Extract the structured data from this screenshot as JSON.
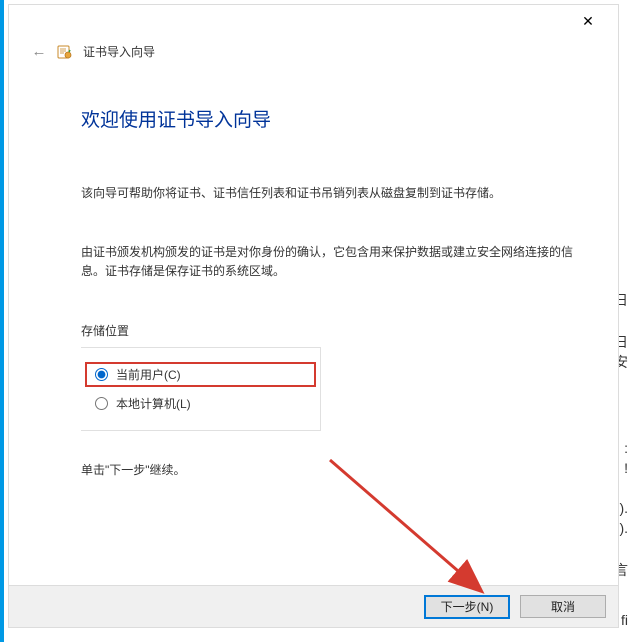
{
  "window": {
    "close_glyph": "✕"
  },
  "header": {
    "back_glyph": "←",
    "label": "证书导入向导"
  },
  "content": {
    "heading": "欢迎使用证书导入向导",
    "paragraph1": "该向导可帮助你将证书、证书信任列表和证书吊销列表从磁盘复制到证书存储。",
    "paragraph2": "由证书颁发机构颁发的证书是对你身份的确认，它包含用来保护数据或建立安全网络连接的信息。证书存储是保存证书的系统区域。",
    "storage_label": "存储位置",
    "radio_current_user": "当前用户(C)",
    "radio_local_machine": "本地计算机(L)",
    "continue_hint": "单击\"下一步\"继续。"
  },
  "buttons": {
    "next": "下一步(N)",
    "cancel": "取消"
  },
  "behind_chars": {
    "c1": "日",
    "c2": "日",
    "c3": "安",
    "c4": ":",
    "c5": "!",
    "c6": ").",
    "c7": ").",
    "c8": "言",
    "c9": "fi"
  }
}
